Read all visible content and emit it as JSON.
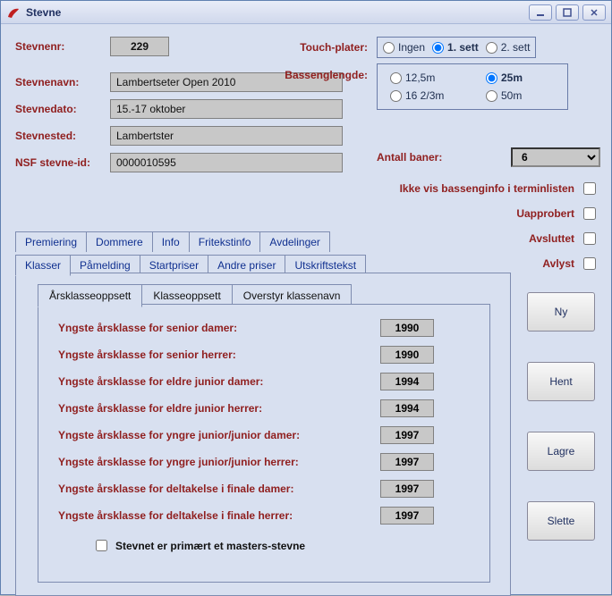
{
  "window": {
    "title": "Stevne"
  },
  "fields": {
    "stevnenr_label": "Stevnenr:",
    "stevnenr_value": "229",
    "stevnenavn_label": "Stevnenavn:",
    "stevnenavn_value": "Lambertseter Open 2010",
    "stevnedato_label": "Stevnedato:",
    "stevnedato_value": "15.-17  oktober",
    "stevnested_label": "Stevnested:",
    "stevnested_value": "Lambertster",
    "nsfid_label": "NSF stevne-id:",
    "nsfid_value": "0000010595"
  },
  "touch": {
    "label": "Touch-plater:",
    "options": [
      "Ingen",
      "1. sett",
      "2. sett"
    ],
    "selected": "1. sett"
  },
  "pool": {
    "label": "Bassenglengde:",
    "options": [
      "12,5m",
      "25m",
      "16 2/3m",
      "50m"
    ],
    "selected": "25m"
  },
  "lanes": {
    "label": "Antall baner:",
    "value": "6"
  },
  "checks": {
    "hide_pool": "Ikke vis bassenginfo i terminlisten",
    "uapprobert": "Uapprobert",
    "avsluttet": "Avsluttet",
    "avlyst": "Avlyst"
  },
  "tabs_upper": [
    "Premiering",
    "Dommere",
    "Info",
    "Fritekstinfo",
    "Avdelinger"
  ],
  "tabs_lower": [
    "Klasser",
    "Påmelding",
    "Startpriser",
    "Andre priser",
    "Utskriftstekst"
  ],
  "tabs_lower_active": "Klasser",
  "subtabs": [
    "Årsklasseoppsett",
    "Klasseoppsett",
    "Overstyr klassenavn"
  ],
  "subtabs_active": "Årsklasseoppsett",
  "years": [
    {
      "label": "Yngste årsklasse for senior damer:",
      "value": "1990"
    },
    {
      "label": "Yngste årsklasse for senior herrer:",
      "value": "1990"
    },
    {
      "label": "Yngste årsklasse for eldre junior damer:",
      "value": "1994"
    },
    {
      "label": "Yngste årsklasse for eldre junior herrer:",
      "value": "1994"
    },
    {
      "label": "Yngste årsklasse for yngre junior/junior damer:",
      "value": "1997"
    },
    {
      "label": "Yngste årsklasse for yngre junior/junior herrer:",
      "value": "1997"
    },
    {
      "label": "Yngste årsklasse for deltakelse i finale damer:",
      "value": "1997"
    },
    {
      "label": "Yngste årsklasse for deltakelse i finale herrer:",
      "value": "1997"
    }
  ],
  "masters_label": "Stevnet er primært et masters-stevne",
  "buttons": {
    "ny": "Ny",
    "hent": "Hent",
    "lagre": "Lagre",
    "slette": "Slette"
  }
}
